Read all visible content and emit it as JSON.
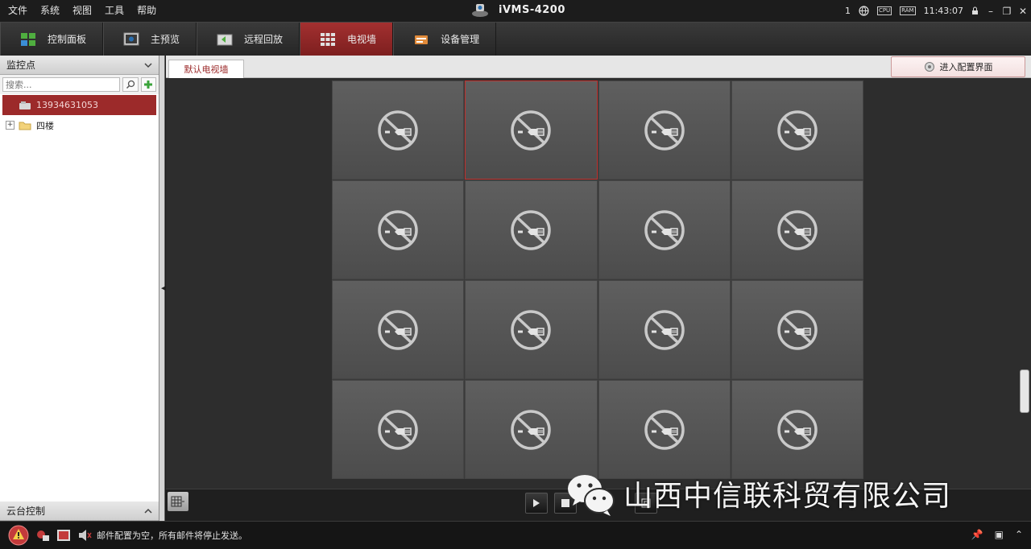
{
  "menu": {
    "items": [
      "文件",
      "系统",
      "视图",
      "工具",
      "帮助"
    ]
  },
  "app": {
    "title": "iVMS-4200"
  },
  "tray": {
    "count": "1",
    "cpu_label": "CPU",
    "ram_label": "RAM",
    "time": "11:43:07"
  },
  "toolbar": {
    "tabs": [
      {
        "label": "控制面板",
        "icon": "control-panel-icon"
      },
      {
        "label": "主预览",
        "icon": "main-view-icon"
      },
      {
        "label": "远程回放",
        "icon": "remote-playback-icon"
      },
      {
        "label": "电视墙",
        "icon": "video-wall-icon",
        "active": true
      },
      {
        "label": "设备管理",
        "icon": "device-management-icon"
      }
    ]
  },
  "left_panel": {
    "header": "监控点",
    "search_placeholder": "搜索...",
    "tree": [
      {
        "label": "13934631053",
        "selected": true
      },
      {
        "label": "四楼",
        "selected": false
      }
    ],
    "ptz_header": "云台控制"
  },
  "main": {
    "wall_tab": "默认电视墙",
    "config_button": "进入配置界面",
    "grid": {
      "rows": 4,
      "cols": 4,
      "selected_index": 1,
      "cell_icon": "no-signal-icon"
    }
  },
  "watermark": {
    "text": "山西中信联科贸有限公司",
    "icon": "wechat-logo"
  },
  "status": {
    "message": "邮件配置为空，所有邮件将停止发送。"
  },
  "colors": {
    "accent_red": "#9c2a2a",
    "selected_cell_border": "#c0302d"
  }
}
